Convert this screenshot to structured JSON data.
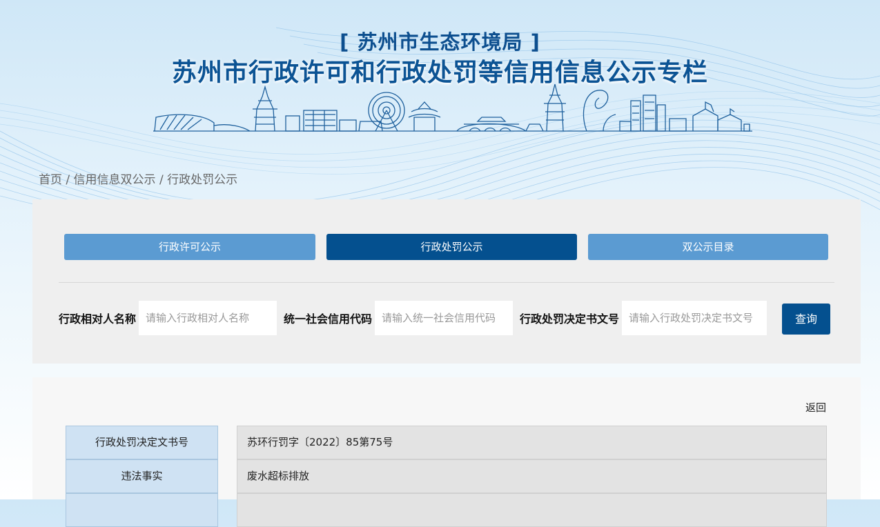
{
  "header": {
    "department": "[ 苏州市生态环境局 ]",
    "title": "苏州市行政许可和行政处罚等信用信息公示专栏"
  },
  "breadcrumb": {
    "home": "首页",
    "section": "信用信息双公示",
    "current": "行政处罚公示",
    "separator": " / "
  },
  "tabs": [
    {
      "label": "行政许可公示",
      "active": false
    },
    {
      "label": "行政处罚公示",
      "active": true
    },
    {
      "label": "双公示目录",
      "active": false
    }
  ],
  "search": {
    "fields": [
      {
        "label": "行政相对人名称",
        "placeholder": "请输入行政相对人名称",
        "value": ""
      },
      {
        "label": "统一社会信用代码",
        "placeholder": "请输入统一社会信用代码",
        "value": ""
      },
      {
        "label": "行政处罚决定书文号",
        "placeholder": "请输入行政处罚决定书文号",
        "value": ""
      }
    ],
    "button_label": "查询"
  },
  "detail": {
    "back_label": "返回",
    "rows": [
      {
        "label": "行政处罚决定文书号",
        "value": "苏环行罚字〔2022〕85第75号"
      },
      {
        "label": "违法事实",
        "value": "废水超标排放"
      },
      {
        "label": "",
        "value": ""
      }
    ]
  },
  "colors": {
    "primary": "#04508f",
    "tab_light": "#5b9bd2",
    "title": "#0b5394",
    "label_bg": "#cfe2f3",
    "value_bg": "#e3e3e3"
  }
}
